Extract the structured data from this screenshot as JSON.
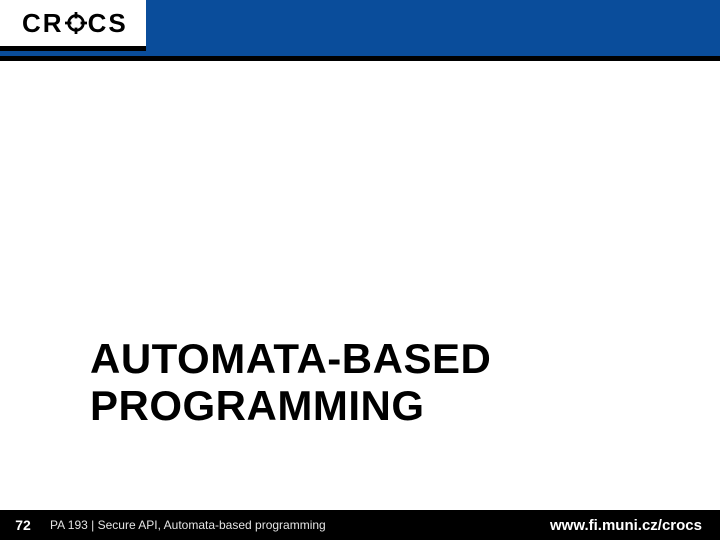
{
  "header": {
    "logo_left": "CR",
    "logo_right": "CS",
    "logo_icon_name": "crosshair-icon"
  },
  "title": {
    "line1": "AUTOMATA-BASED",
    "line2": "PROGRAMMING"
  },
  "footer": {
    "page_number": "72",
    "course_text": "PA 193 | Secure API, Automata-based programming",
    "url": "www.fi.muni.cz/crocs"
  },
  "colors": {
    "brand_blue": "#0a4d9b",
    "black": "#000000"
  }
}
